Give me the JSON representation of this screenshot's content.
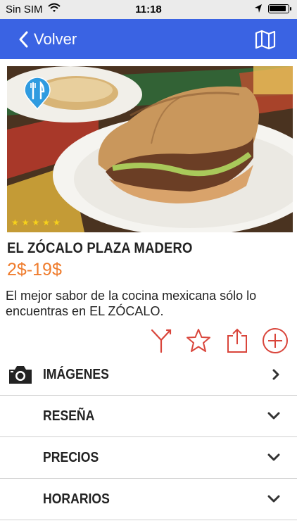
{
  "status_bar": {
    "carrier": "Sin SIM",
    "time": "11:18"
  },
  "nav": {
    "back_label": "Volver",
    "map_icon": "map-icon"
  },
  "place": {
    "rating_stars": 5,
    "name": "EL ZÓCALO PLAZA MADERO",
    "price": "2$-19$",
    "description": "El mejor sabor de la cocina mexicana sólo lo encuentras en EL ZÓCALO."
  },
  "actions": [
    {
      "icon": "directions-icon"
    },
    {
      "icon": "favorite-star-icon"
    },
    {
      "icon": "share-icon"
    },
    {
      "icon": "add-circle-icon"
    }
  ],
  "sections": [
    {
      "label": "IMÁGENES",
      "icon": "camera-icon",
      "arrow": "chevron-right-icon"
    },
    {
      "label": "RESEÑA",
      "arrow": "chevron-down-icon"
    },
    {
      "label": "PRECIOS",
      "arrow": "chevron-down-icon"
    },
    {
      "label": "HORARIOS",
      "arrow": "chevron-down-icon"
    }
  ],
  "colors": {
    "nav": "#3a63e3",
    "accent": "#ef7c2d",
    "action_icons": "#d9453b",
    "stars": "#f7d21a"
  }
}
